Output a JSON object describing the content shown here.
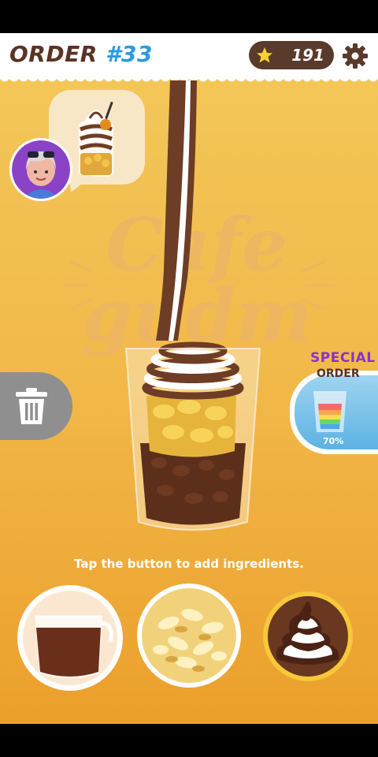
{
  "header": {
    "order_label": "ORDER",
    "order_number": "#33",
    "score": "191",
    "star_icon": "star-icon",
    "settings_icon": "gear-icon"
  },
  "watermark": {
    "line1": "Cafe",
    "line2": "gudm"
  },
  "special_order": {
    "title": "SPECIAL",
    "subtitle": "ORDER",
    "progress": "70%"
  },
  "hint": "Tap the button to add ingredients.",
  "ingredients": [
    {
      "name": "coffee"
    },
    {
      "name": "cereal flakes"
    },
    {
      "name": "chocolate whipped cream"
    }
  ],
  "colors": {
    "accent_blue": "#2a9be0",
    "brown": "#5a3324",
    "special_purple": "#8a2fd6",
    "background_top": "#f4c85a",
    "background_bottom": "#ec9f2b"
  }
}
